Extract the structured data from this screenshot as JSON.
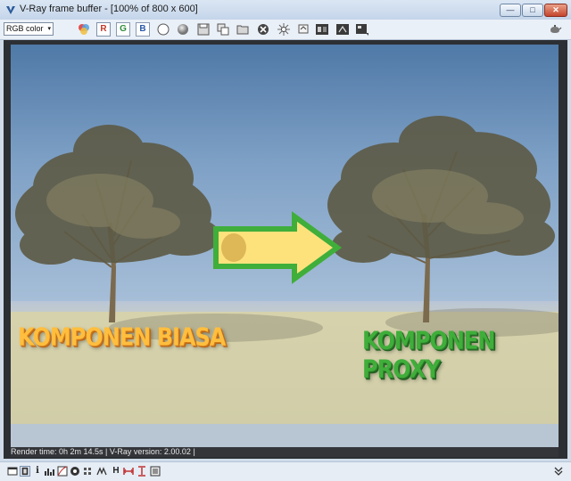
{
  "window": {
    "title": "V-Ray frame buffer - [100% of 800 x 600]",
    "minimize_glyph": "—",
    "maximize_glyph": "□",
    "close_glyph": "✕"
  },
  "toolbar": {
    "channel_select": {
      "value": "RGB color",
      "arrow": "▾"
    },
    "channels": {
      "r": "R",
      "g": "G",
      "b": "B"
    },
    "icons": [
      "color-swatches-icon",
      "channel-r-button",
      "channel-g-button",
      "channel-b-button",
      "alpha-circle-icon",
      "mono-sphere-icon",
      "save-icon",
      "clone-icon",
      "open-icon",
      "clear-icon",
      "track-mouse-icon",
      "region-render-icon",
      "compare-ab-icon",
      "lut-icon",
      "settings-icon"
    ]
  },
  "render": {
    "left_label": "KOMPONEN BIASA",
    "right_label": "KOMPONEN PROXY",
    "colors": {
      "left_label": "#ffbe3d",
      "right_label": "#3fae3a",
      "arrow_fill": "#fde27c",
      "arrow_stroke": "#3fae3a"
    }
  },
  "status": {
    "text": "Render time:  0h  2m 14.5s | V-Ray version: 2.00.02 |"
  },
  "bottom_toolbar": {
    "labels": {
      "info": "i",
      "histogram": "H"
    }
  }
}
